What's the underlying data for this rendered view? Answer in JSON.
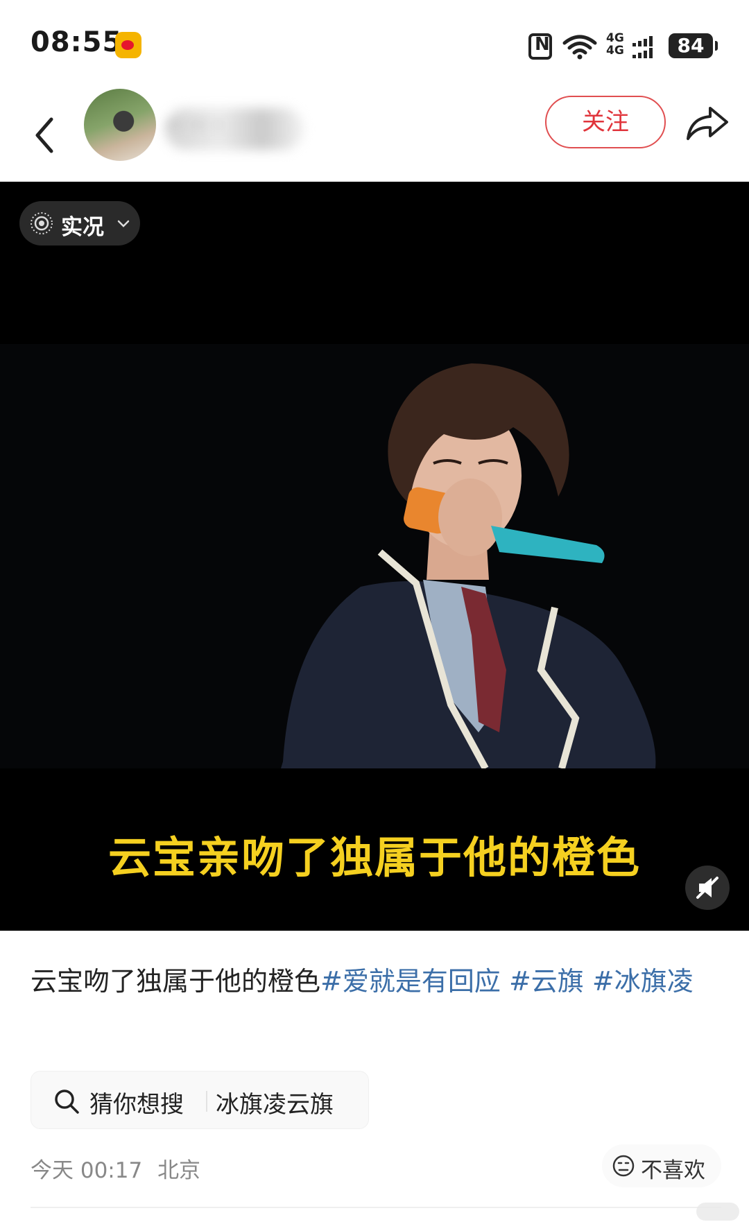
{
  "status_bar": {
    "time": "08:55",
    "signal_label": "4G\n4G",
    "battery": "84"
  },
  "header": {
    "username": "·· ·· ·",
    "follow_label": "关注"
  },
  "media": {
    "live_label": "实况",
    "video_caption": "云宝亲吻了独属于他的橙色"
  },
  "post": {
    "text": "云宝吻了独属于他的橙色",
    "hashtags": [
      "#爱就是有回应",
      "#云旗",
      "#冰旗凌"
    ],
    "search_suggestion": {
      "label": "猜你想搜",
      "term": "冰旗凌云旗"
    },
    "meta": {
      "time": "今天 00:17",
      "location": "北京"
    },
    "dislike_label": "不喜欢"
  },
  "colors": {
    "follow": "#e0343b",
    "hashtag": "#3b6ea8",
    "caption": "#f5d020"
  },
  "icons": [
    "weibo-icon",
    "nfc-icon",
    "wifi-icon",
    "signal-icon",
    "battery-icon",
    "back-icon",
    "share-icon",
    "live-photo-icon",
    "chevron-down-icon",
    "mute-icon",
    "search-icon",
    "dislike-face-icon"
  ]
}
